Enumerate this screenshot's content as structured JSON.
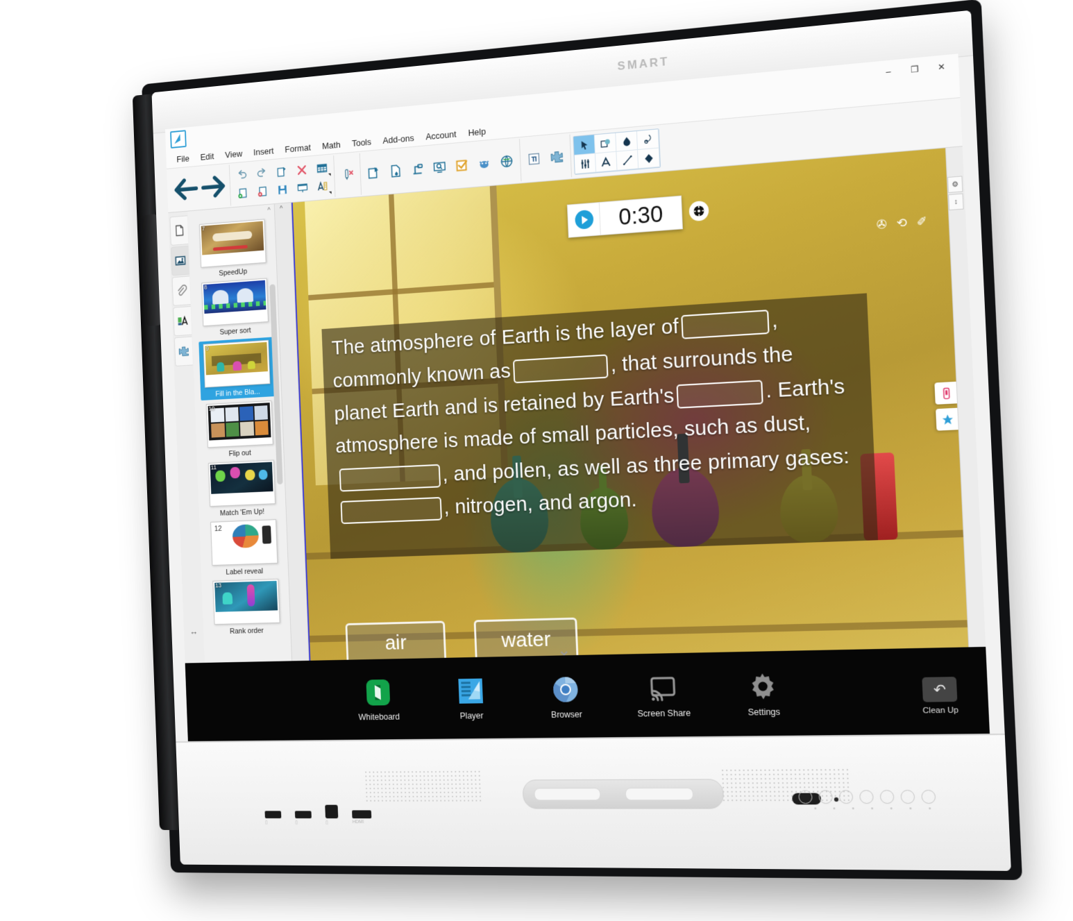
{
  "device": {
    "brand": "SMART",
    "clean_up_label": "Clean Up",
    "clean_up_icon": "undo-arrow-icon"
  },
  "app": {
    "title_icon": "smart-notebook-icon",
    "window_controls": {
      "minimize": "–",
      "maximize": "❐",
      "close": "✕"
    },
    "menus": [
      "File",
      "Edit",
      "View",
      "Insert",
      "Format",
      "Math",
      "Tools",
      "Add-ons",
      "Account",
      "Help"
    ],
    "toolbar": {
      "nav": [
        {
          "name": "previous-page-button",
          "icon": "arrow-left-icon",
          "glyph": "←"
        },
        {
          "name": "next-page-button",
          "icon": "arrow-right-icon",
          "glyph": "→"
        }
      ],
      "groups": [
        {
          "name": "edit-group",
          "row1": [
            {
              "name": "undo-button",
              "icon": "undo-icon"
            },
            {
              "name": "redo-button",
              "icon": "redo-icon"
            },
            {
              "name": "add-page-button",
              "icon": "page-add-icon"
            },
            {
              "name": "delete-button",
              "icon": "delete-x-icon"
            },
            {
              "name": "insert-table-button",
              "icon": "table-icon",
              "has_caret": true
            }
          ],
          "row2": [
            {
              "name": "new-page-button",
              "icon": "page-new-icon"
            },
            {
              "name": "close-page-button",
              "icon": "page-close-icon"
            },
            {
              "name": "save-button",
              "icon": "save-disk-icon"
            },
            {
              "name": "full-screen-button",
              "icon": "screen-icon"
            },
            {
              "name": "text-format-button",
              "icon": "text-measure-icon",
              "has_caret": true
            }
          ]
        },
        {
          "name": "clear-ink-group",
          "items": [
            {
              "name": "clear-ink-button",
              "icon": "clear-ink-icon"
            }
          ]
        },
        {
          "name": "insert-group",
          "items": [
            {
              "name": "screen-capture-button",
              "icon": "capture-icon"
            },
            {
              "name": "insert-file-button",
              "icon": "file-drop-icon"
            },
            {
              "name": "document-camera-button",
              "icon": "doc-camera-icon"
            },
            {
              "name": "screen-shade-button",
              "icon": "screen-magnify-icon",
              "has_caret": true
            },
            {
              "name": "smart-response-button",
              "icon": "checkbox-orange-icon"
            },
            {
              "name": "smart-lab-button",
              "icon": "lab-bug-icon"
            },
            {
              "name": "browser-button",
              "icon": "globe-icon"
            }
          ]
        },
        {
          "name": "math-group",
          "items": [
            {
              "name": "math-equation-button",
              "icon": "pi-icon"
            },
            {
              "name": "add-ons-button",
              "icon": "puzzle-icon"
            }
          ]
        }
      ],
      "palette": {
        "row1": [
          {
            "name": "select-tool",
            "icon": "cursor-arrow-icon",
            "selected": true
          },
          {
            "name": "shape-tool",
            "icon": "shape-icon",
            "selected": false
          },
          {
            "name": "fill-tool",
            "icon": "fill-drop-icon",
            "selected": false
          },
          {
            "name": "pen-tool",
            "icon": "pen-nib-icon",
            "selected": false
          }
        ],
        "row2": [
          {
            "name": "properties-tool",
            "icon": "sliders-icon",
            "selected": false
          },
          {
            "name": "text-tool",
            "icon": "letter-a-icon",
            "selected": false
          },
          {
            "name": "line-tool",
            "icon": "line-icon",
            "selected": false
          },
          {
            "name": "eraser-tool",
            "icon": "eraser-icon",
            "selected": false
          }
        ]
      }
    },
    "sidebar": {
      "tabs": [
        {
          "name": "page-sorter-tab",
          "icon": "page-icon",
          "active": false
        },
        {
          "name": "gallery-tab",
          "icon": "gallery-image-icon",
          "active": true
        },
        {
          "name": "attachments-tab",
          "icon": "paperclip-icon",
          "active": false
        },
        {
          "name": "properties-tab",
          "icon": "properties-a-icon",
          "active": false
        },
        {
          "name": "addons-tab",
          "icon": "puzzle-piece-icon",
          "active": false
        }
      ],
      "resize_icon": "horizontal-resize-icon",
      "thumbnails": [
        {
          "number": "7",
          "label": "SpeedUp",
          "selected": false,
          "theme": "speedup"
        },
        {
          "number": "8",
          "label": "Super sort",
          "selected": false,
          "theme": "supersort"
        },
        {
          "number": "9",
          "label": "Fill in the Bla...",
          "selected": true,
          "theme": "fillblank"
        },
        {
          "number": "10",
          "label": "Flip out",
          "selected": false,
          "theme": "flipout"
        },
        {
          "number": "11",
          "label": "Match 'Em Up!",
          "selected": false,
          "theme": "match"
        },
        {
          "number": "12",
          "label": "Label reveal",
          "selected": false,
          "theme": "label"
        },
        {
          "number": "13",
          "label": "Rank order",
          "selected": false,
          "theme": "rank"
        }
      ]
    },
    "lesson": {
      "activity_type": "Fill in the Blanks",
      "timer": {
        "value": "0:30",
        "play_icon": "play-icon",
        "settings_icon": "gear-icon"
      },
      "top_right_icons": [
        {
          "name": "mute-icon",
          "glyph": "✇"
        },
        {
          "name": "restart-icon",
          "glyph": "⟲"
        },
        {
          "name": "edit-pencil-icon",
          "glyph": "✐"
        }
      ],
      "side_widgets": [
        {
          "name": "mobile-device-icon"
        },
        {
          "name": "favorite-star-icon"
        }
      ],
      "sentence": {
        "part1": "The atmosphere of Earth is the layer of",
        "part2": ", commonly known as",
        "part3": ", that surrounds the planet Earth and is retained by Earth's",
        "part4": ". Earth's atmosphere is made of small particles, such as dust,",
        "part5": ", and pollen, as well as three primary gases:",
        "part6": ", nitrogen, and argon.",
        "blank_count": 5
      },
      "answer_tiles": [
        {
          "label": "air"
        },
        {
          "label": "water"
        }
      ]
    }
  },
  "taskbar": {
    "collapse_icon": "chevron-down-icon",
    "apps": [
      {
        "name": "whiteboard-app",
        "label": "Whiteboard",
        "icon": "whiteboard-icon",
        "color": "#12a34a"
      },
      {
        "name": "player-app",
        "label": "Player",
        "icon": "player-icon",
        "color": "#3aa7e6"
      },
      {
        "name": "browser-app",
        "label": "Browser",
        "icon": "chromium-icon",
        "color": "#4a86c8"
      },
      {
        "name": "screen-share-app",
        "label": "Screen Share",
        "icon": "cast-icon",
        "color": "#9a9a9a"
      },
      {
        "name": "settings-app",
        "label": "Settings",
        "icon": "gear-icon",
        "color": "#9a9a9a"
      }
    ]
  },
  "colors": {
    "accent_blue": "#2fa3e0",
    "selection_blue": "#7fc2ec",
    "canvas_border": "#3b3bd6",
    "taskbar_bg": "#060606"
  }
}
